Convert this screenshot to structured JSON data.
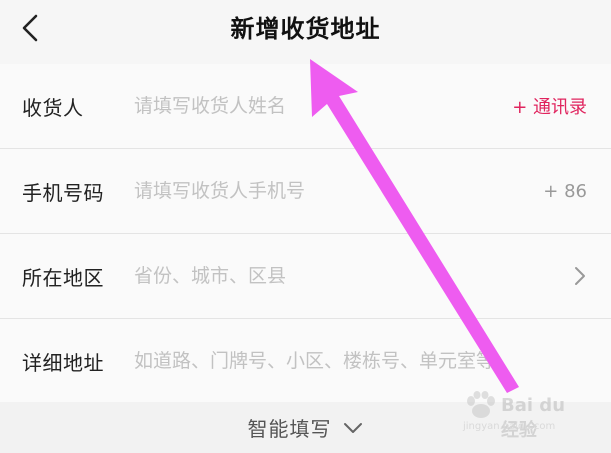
{
  "header": {
    "title": "新增收货地址"
  },
  "form": {
    "rows": [
      {
        "label": "收货人",
        "placeholder": "请填写收货人姓名",
        "suffix": "+ 通讯录"
      },
      {
        "label": "手机号码",
        "placeholder": "请填写收货人手机号",
        "suffix": "+ 86"
      },
      {
        "label": "所在地区",
        "placeholder": "省份、城市、区县"
      },
      {
        "label": "详细地址",
        "placeholder": "如道路、门牌号、小区、楼栋号、单元室等"
      }
    ]
  },
  "smart_fill": {
    "label": "智能填写"
  },
  "colors": {
    "accent": "#e0245e",
    "annotation_arrow": "#ee5cf0"
  },
  "icons": {
    "back": "back-chevron-icon",
    "region_chevron": "chevron-right-icon",
    "smart_chevron": "chevron-down-icon"
  },
  "watermark": {
    "logo_text": "Bai du 经验",
    "url": "jingyan.baidu.com"
  }
}
